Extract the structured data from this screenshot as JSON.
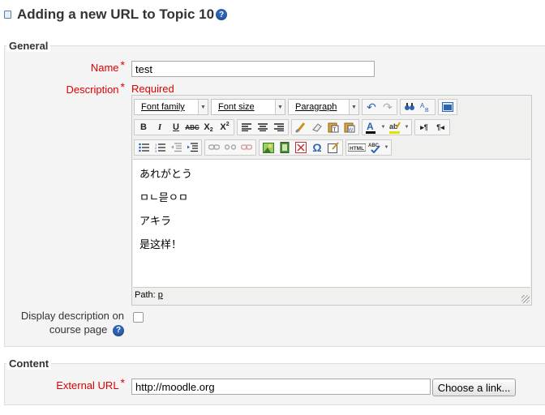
{
  "page": {
    "title": "Adding a new URL to Topic 10"
  },
  "general": {
    "legend": "General",
    "name_label": "Name",
    "name_value": "test",
    "description_label": "Description",
    "required_text": "Required",
    "display_desc_label_1": "Display description on",
    "display_desc_label_2": "course page",
    "display_desc_checked": false
  },
  "editor": {
    "font_family": "Font family",
    "font_size": "Font size",
    "format": "Paragraph",
    "content": [
      "あれがとう",
      "ㅁㄴ믇ㅇㅁ",
      "アキラ",
      "是这样！"
    ],
    "path_label": "Path:",
    "path_value": "p"
  },
  "content": {
    "legend": "Content",
    "url_label": "External URL",
    "url_value": "http://moodle.org",
    "choose_button": "Choose a link..."
  },
  "help_glyph": "?",
  "required_marker": "*"
}
